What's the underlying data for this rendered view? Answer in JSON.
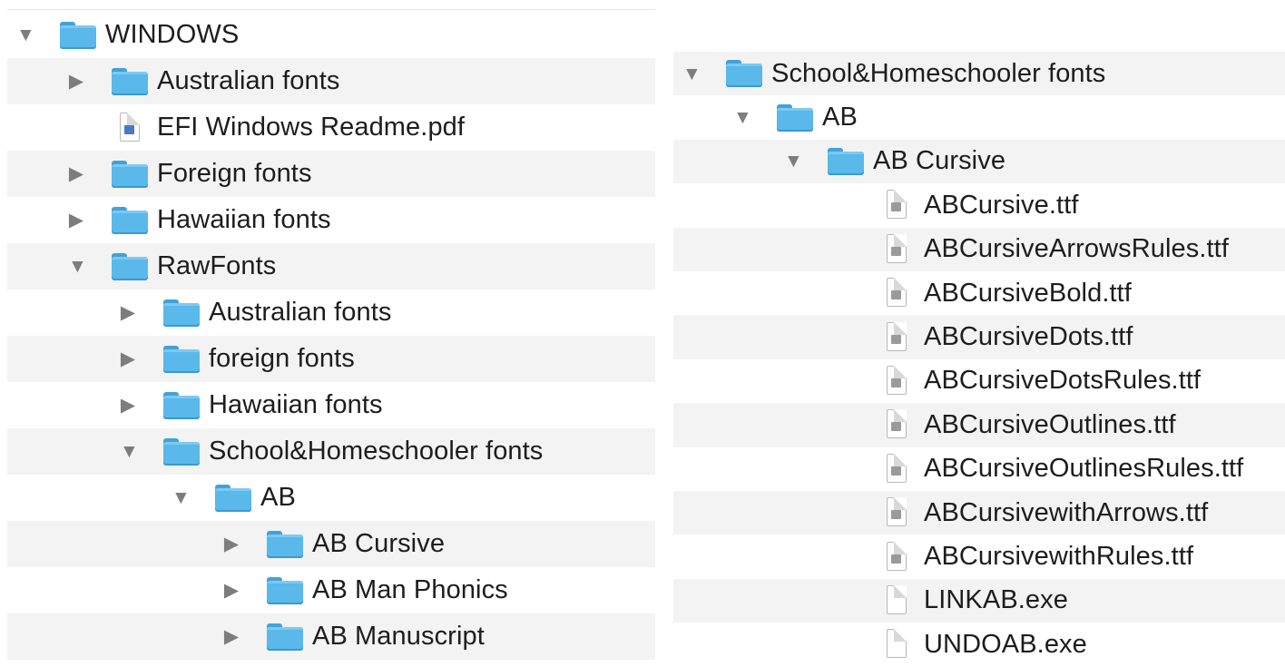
{
  "left_pane": {
    "rows": [
      {
        "label": "WINDOWS",
        "type": "folder",
        "expander": "expanded",
        "depth": 0
      },
      {
        "label": "Australian fonts",
        "type": "folder",
        "expander": "collapsed",
        "depth": 1
      },
      {
        "label": "EFI Windows Readme.pdf",
        "type": "pdf-file",
        "expander": "none",
        "depth": 1
      },
      {
        "label": "Foreign fonts",
        "type": "folder",
        "expander": "collapsed",
        "depth": 1
      },
      {
        "label": "Hawaiian fonts",
        "type": "folder",
        "expander": "collapsed",
        "depth": 1
      },
      {
        "label": "RawFonts",
        "type": "folder",
        "expander": "expanded",
        "depth": 1
      },
      {
        "label": "Australian fonts",
        "type": "folder",
        "expander": "collapsed",
        "depth": 2
      },
      {
        "label": "foreign fonts",
        "type": "folder",
        "expander": "collapsed",
        "depth": 2
      },
      {
        "label": "Hawaiian fonts",
        "type": "folder",
        "expander": "collapsed",
        "depth": 2
      },
      {
        "label": "School&Homeschooler fonts",
        "type": "folder",
        "expander": "expanded",
        "depth": 2
      },
      {
        "label": "AB",
        "type": "folder",
        "expander": "expanded",
        "depth": 3
      },
      {
        "label": "AB Cursive",
        "type": "folder",
        "expander": "collapsed",
        "depth": 4
      },
      {
        "label": "AB Man Phonics",
        "type": "folder",
        "expander": "collapsed",
        "depth": 4
      },
      {
        "label": "AB Manuscript",
        "type": "folder",
        "expander": "collapsed",
        "depth": 4
      }
    ]
  },
  "right_pane": {
    "rows": [
      {
        "label": "School&Homeschooler fonts",
        "type": "folder",
        "expander": "expanded",
        "depth": 0
      },
      {
        "label": "AB",
        "type": "folder",
        "expander": "expanded",
        "depth": 1
      },
      {
        "label": "AB Cursive",
        "type": "folder",
        "expander": "expanded",
        "depth": 2
      },
      {
        "label": "ABCursive.ttf",
        "type": "font-file",
        "expander": "none",
        "depth": 3
      },
      {
        "label": "ABCursiveArrowsRules.ttf",
        "type": "font-file",
        "expander": "none",
        "depth": 3
      },
      {
        "label": "ABCursiveBold.ttf",
        "type": "font-file",
        "expander": "none",
        "depth": 3
      },
      {
        "label": "ABCursiveDots.ttf",
        "type": "font-file",
        "expander": "none",
        "depth": 3
      },
      {
        "label": "ABCursiveDotsRules.ttf",
        "type": "font-file",
        "expander": "none",
        "depth": 3
      },
      {
        "label": "ABCursiveOutlines.ttf",
        "type": "font-file",
        "expander": "none",
        "depth": 3
      },
      {
        "label": "ABCursiveOutlinesRules.ttf",
        "type": "font-file",
        "expander": "none",
        "depth": 3
      },
      {
        "label": "ABCursivewithArrows.ttf",
        "type": "font-file",
        "expander": "none",
        "depth": 3
      },
      {
        "label": "ABCursivewithRules.ttf",
        "type": "font-file",
        "expander": "none",
        "depth": 3
      },
      {
        "label": "LINKAB.exe",
        "type": "exe-file",
        "expander": "none",
        "depth": 3
      },
      {
        "label": "UNDOAB.exe",
        "type": "exe-file",
        "expander": "none",
        "depth": 3
      }
    ]
  },
  "colors": {
    "folder_blue": "#5ab8ea",
    "stripe_gray": "#f3f3f3",
    "disclosure_gray": "#7d7d7d"
  },
  "icons": {
    "expanded": "disclosure-triangle-down",
    "collapsed": "disclosure-triangle-right",
    "folder": "folder-icon",
    "pdf-file": "pdf-document-icon",
    "font-file": "font-file-icon",
    "exe-file": "generic-document-icon"
  }
}
